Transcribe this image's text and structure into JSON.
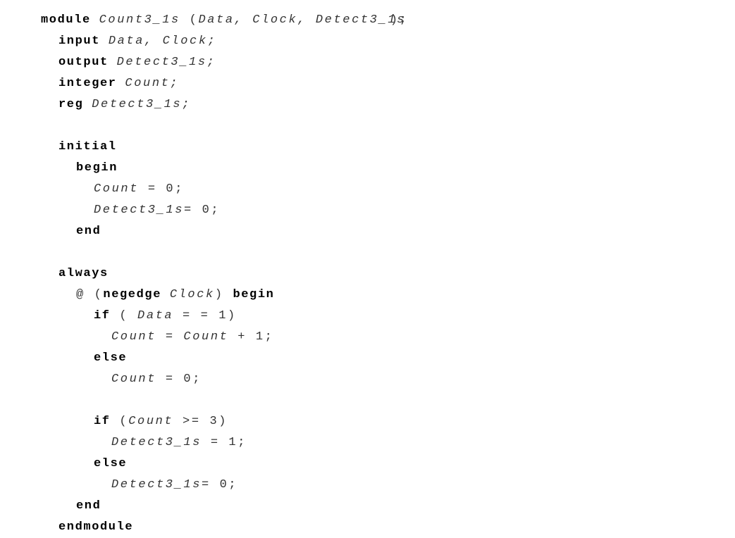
{
  "lines": [
    {
      "indent": 0,
      "tokens": [
        {
          "k": "kw",
          "t": "module "
        },
        {
          "k": "id",
          "t": "Count3_1s"
        },
        {
          "k": "op",
          "t": " ("
        },
        {
          "k": "id",
          "t": "Data, Clock, Detect3_1s"
        },
        {
          "k": "ov",
          "t": ");"
        }
      ]
    },
    {
      "indent": 1,
      "tokens": [
        {
          "k": "kw",
          "t": "input "
        },
        {
          "k": "id",
          "t": "Data, Clock;"
        }
      ]
    },
    {
      "indent": 1,
      "tokens": [
        {
          "k": "kw",
          "t": "output "
        },
        {
          "k": "id",
          "t": "Detect3_1s;"
        }
      ]
    },
    {
      "indent": 1,
      "tokens": [
        {
          "k": "kw",
          "t": "integer "
        },
        {
          "k": "id",
          "t": "Count;"
        }
      ]
    },
    {
      "indent": 1,
      "tokens": [
        {
          "k": "kw",
          "t": "reg "
        },
        {
          "k": "id",
          "t": "Detect3_1s;"
        }
      ]
    },
    {
      "indent": 0,
      "tokens": []
    },
    {
      "indent": 1,
      "tokens": [
        {
          "k": "kw",
          "t": "initial"
        }
      ]
    },
    {
      "indent": 2,
      "tokens": [
        {
          "k": "kw",
          "t": "begin"
        }
      ]
    },
    {
      "indent": 3,
      "tokens": [
        {
          "k": "id",
          "t": "Count"
        },
        {
          "k": "op",
          "t": " = 0;"
        }
      ]
    },
    {
      "indent": 3,
      "tokens": [
        {
          "k": "id",
          "t": "Detect3_1s"
        },
        {
          "k": "op",
          "t": "= 0;"
        }
      ]
    },
    {
      "indent": 2,
      "tokens": [
        {
          "k": "kw",
          "t": "end"
        }
      ]
    },
    {
      "indent": 0,
      "tokens": []
    },
    {
      "indent": 1,
      "tokens": [
        {
          "k": "kw",
          "t": "always"
        }
      ]
    },
    {
      "indent": 2,
      "tokens": [
        {
          "k": "op",
          "t": "@ ("
        },
        {
          "k": "kw",
          "t": "negedge "
        },
        {
          "k": "id",
          "t": "Clock"
        },
        {
          "k": "op",
          "t": ") "
        },
        {
          "k": "kw",
          "t": "begin"
        }
      ]
    },
    {
      "indent": 3,
      "tokens": [
        {
          "k": "kw",
          "t": "if"
        },
        {
          "k": "op",
          "t": " ( "
        },
        {
          "k": "id",
          "t": "Data"
        },
        {
          "k": "op",
          "t": " = = 1)"
        }
      ]
    },
    {
      "indent": 4,
      "tokens": [
        {
          "k": "id",
          "t": "Count"
        },
        {
          "k": "op",
          "t": " = "
        },
        {
          "k": "id",
          "t": "Count"
        },
        {
          "k": "op",
          "t": " + 1;"
        }
      ]
    },
    {
      "indent": 3,
      "tokens": [
        {
          "k": "kw",
          "t": "else"
        }
      ]
    },
    {
      "indent": 4,
      "tokens": [
        {
          "k": "id",
          "t": "Count"
        },
        {
          "k": "op",
          "t": " = 0;"
        }
      ]
    },
    {
      "indent": 0,
      "tokens": []
    },
    {
      "indent": 3,
      "tokens": [
        {
          "k": "kw",
          "t": "if"
        },
        {
          "k": "op",
          "t": " ("
        },
        {
          "k": "id",
          "t": "Count"
        },
        {
          "k": "op",
          "t": " >= 3)"
        }
      ]
    },
    {
      "indent": 4,
      "tokens": [
        {
          "k": "id",
          "t": "Detect3_1s"
        },
        {
          "k": "op",
          "t": " = 1;"
        }
      ]
    },
    {
      "indent": 3,
      "tokens": [
        {
          "k": "kw",
          "t": "else"
        }
      ]
    },
    {
      "indent": 4,
      "tokens": [
        {
          "k": "id",
          "t": "Detect3_1s"
        },
        {
          "k": "op",
          "t": "= 0;"
        }
      ]
    },
    {
      "indent": 2,
      "tokens": [
        {
          "k": "kw",
          "t": "end"
        }
      ]
    },
    {
      "indent": 1,
      "tokens": [
        {
          "k": "kw",
          "t": "endmodule"
        }
      ]
    }
  ]
}
